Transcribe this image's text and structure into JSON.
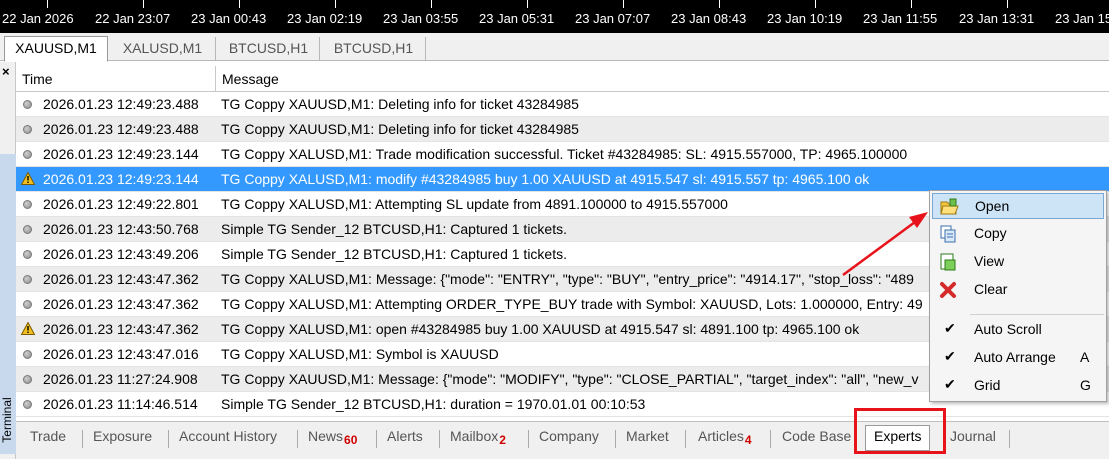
{
  "timeline": {
    "labels": [
      "22 Jan 2026",
      "22 Jan 23:07",
      "23 Jan 00:43",
      "23 Jan 02:19",
      "23 Jan 03:55",
      "23 Jan 05:31",
      "23 Jan 07:07",
      "23 Jan 08:43",
      "23 Jan 10:19",
      "23 Jan 11:55",
      "23 Jan 13:31",
      "23 Jan 15"
    ]
  },
  "chart_tabs": [
    "XAUUSD,M1",
    "XALUSD,M1",
    "BTCUSD,H1",
    "BTCUSD,H1"
  ],
  "left_strip": {
    "close": "×",
    "terminal_label": "Terminal"
  },
  "table": {
    "headers": {
      "time": "Time",
      "message": "Message"
    },
    "rows": [
      {
        "icon": "info-dot-icon",
        "time": "2026.01.23 12:49:23.488",
        "message": "TG Coppy XAUUSD,M1: Deleting info for ticket 43284985"
      },
      {
        "icon": "info-dot-icon",
        "time": "2026.01.23 12:49:23.488",
        "message": "TG Coppy XAUUSD,M1: Deleting info for ticket 43284985"
      },
      {
        "icon": "info-dot-icon",
        "time": "2026.01.23 12:49:23.144",
        "message": "TG Coppy XALUSD,M1: Trade modification successful. Ticket #43284985: SL: 4915.557000, TP: 4965.100000"
      },
      {
        "icon": "warning-icon",
        "time": "2026.01.23 12:49:23.144",
        "message": "TG Coppy XALUSD,M1: modify #43284985 buy 1.00 XAUUSD at 4915.547 sl: 4915.557 tp: 4965.100 ok"
      },
      {
        "icon": "info-dot-icon",
        "time": "2026.01.23 12:49:22.801",
        "message": "TG Coppy XALUSD,M1: Attempting SL update from 4891.100000 to 4915.557000"
      },
      {
        "icon": "info-dot-icon",
        "time": "2026.01.23 12:43:50.768",
        "message": "Simple TG Sender_12 BTCUSD,H1: Captured 1 tickets."
      },
      {
        "icon": "info-dot-icon",
        "time": "2026.01.23 12:43:49.206",
        "message": "Simple TG Sender_12 BTCUSD,H1: Captured 1 tickets."
      },
      {
        "icon": "info-dot-icon",
        "time": "2026.01.23 12:43:47.362",
        "message": "TG Coppy XALUSD,M1: Message: {\"mode\": \"ENTRY\", \"type\": \"BUY\", \"entry_price\": \"4914.17\", \"stop_loss\": \"489"
      },
      {
        "icon": "info-dot-icon",
        "time": "2026.01.23 12:43:47.362",
        "message": "TG Coppy XALUSD,M1: Attempting ORDER_TYPE_BUY trade with Symbol: XAUUSD, Lots: 1.000000, Entry: 49"
      },
      {
        "icon": "warning-icon",
        "time": "2026.01.23 12:43:47.362",
        "message": "TG Coppy XALUSD,M1: open #43284985 buy 1.00 XAUUSD at 4915.547 sl: 4891.100 tp: 4965.100 ok"
      },
      {
        "icon": "info-dot-icon",
        "time": "2026.01.23 12:43:47.016",
        "message": "TG Coppy XALUSD,M1: Symbol is XAUUSD"
      },
      {
        "icon": "info-dot-icon",
        "time": "2026.01.23 11:27:24.908",
        "message": "TG Coppy XAUUSD,M1: Message: {\"mode\": \"MODIFY\", \"type\": \"CLOSE_PARTIAL\", \"target_index\": \"all\", \"new_v"
      },
      {
        "icon": "info-dot-icon",
        "time": "2026.01.23 11:14:46.514",
        "message": "Simple TG Sender_12 BTCUSD,H1: duration = 1970.01.01 00:10:53"
      }
    ]
  },
  "context_menu": {
    "items": [
      {
        "label": "Open",
        "icon": "open-folder-icon",
        "key": ""
      },
      {
        "label": "Copy",
        "icon": "copy-icon",
        "key": ""
      },
      {
        "label": "View",
        "icon": "view-icon",
        "key": ""
      },
      {
        "label": "Clear",
        "icon": "clear-x-icon",
        "key": ""
      },
      {
        "label": "Auto Scroll",
        "icon": "checkmark-icon",
        "key": ""
      },
      {
        "label": "Auto Arrange",
        "icon": "checkmark-icon",
        "key": "A"
      },
      {
        "label": "Grid",
        "icon": "checkmark-icon",
        "key": "G"
      }
    ]
  },
  "bottom_tabs": [
    {
      "label": "Trade",
      "badge": ""
    },
    {
      "label": "Exposure",
      "badge": ""
    },
    {
      "label": "Account History",
      "badge": ""
    },
    {
      "label": "News",
      "badge": "60"
    },
    {
      "label": "Alerts",
      "badge": ""
    },
    {
      "label": "Mailbox",
      "badge": "2"
    },
    {
      "label": "Company",
      "badge": ""
    },
    {
      "label": "Market",
      "badge": ""
    },
    {
      "label": "Articles",
      "badge": "4"
    },
    {
      "label": "Code Base",
      "badge": ""
    },
    {
      "label": "Experts",
      "badge": ""
    },
    {
      "label": "Journal",
      "badge": ""
    }
  ],
  "colors": {
    "selection": "#3399ff",
    "annotation_red": "#e8131a",
    "badge_red": "#d00000",
    "timeline_bg": "#000000"
  }
}
